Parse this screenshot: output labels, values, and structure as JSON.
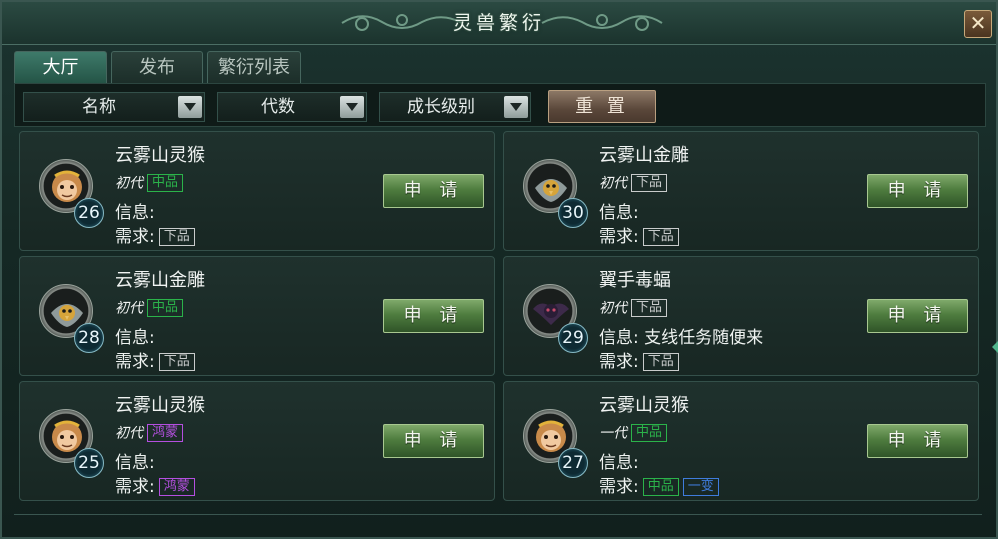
{
  "window": {
    "title": "灵兽繁衍",
    "close_glyph": "✕"
  },
  "tabs": [
    {
      "label": "大厅",
      "active": true
    },
    {
      "label": "发布",
      "active": false
    },
    {
      "label": "繁衍列表",
      "active": false
    }
  ],
  "filters": {
    "name": "名称",
    "generation": "代数",
    "growth": "成长级别",
    "reset": "重 置"
  },
  "labels": {
    "info": "信息:",
    "need": "需求:",
    "apply": "申 请"
  },
  "colors": {
    "grade_zhongpin": "#2bb34a",
    "grade_xiapin": "#c9cccc",
    "grade_hongmeng": "#b44fe0",
    "grade_yibian": "#3f7cdc"
  },
  "cards": [
    {
      "name": "云雾山灵猴",
      "generation": "初代",
      "grade": "中品",
      "level": "26",
      "info": "",
      "need": [
        "下品"
      ],
      "icon": "monkey-icon"
    },
    {
      "name": "云雾山金雕",
      "generation": "初代",
      "grade": "下品",
      "level": "30",
      "info": "",
      "need": [
        "下品"
      ],
      "icon": "eagle-icon"
    },
    {
      "name": "云雾山金雕",
      "generation": "初代",
      "grade": "中品",
      "level": "28",
      "info": "",
      "need": [
        "下品"
      ],
      "icon": "eagle-icon"
    },
    {
      "name": "翼手毒蝠",
      "generation": "初代",
      "grade": "下品",
      "level": "29",
      "info": "支线任务随便来",
      "need": [
        "下品"
      ],
      "icon": "bat-icon"
    },
    {
      "name": "云雾山灵猴",
      "generation": "初代",
      "grade": "鸿蒙",
      "level": "25",
      "info": "",
      "need": [
        "鸿蒙"
      ],
      "icon": "monkey-icon"
    },
    {
      "name": "云雾山灵猴",
      "generation": "一代",
      "grade": "中品",
      "level": "27",
      "info": "",
      "need": [
        "中品",
        "一变"
      ],
      "icon": "monkey-icon"
    }
  ]
}
